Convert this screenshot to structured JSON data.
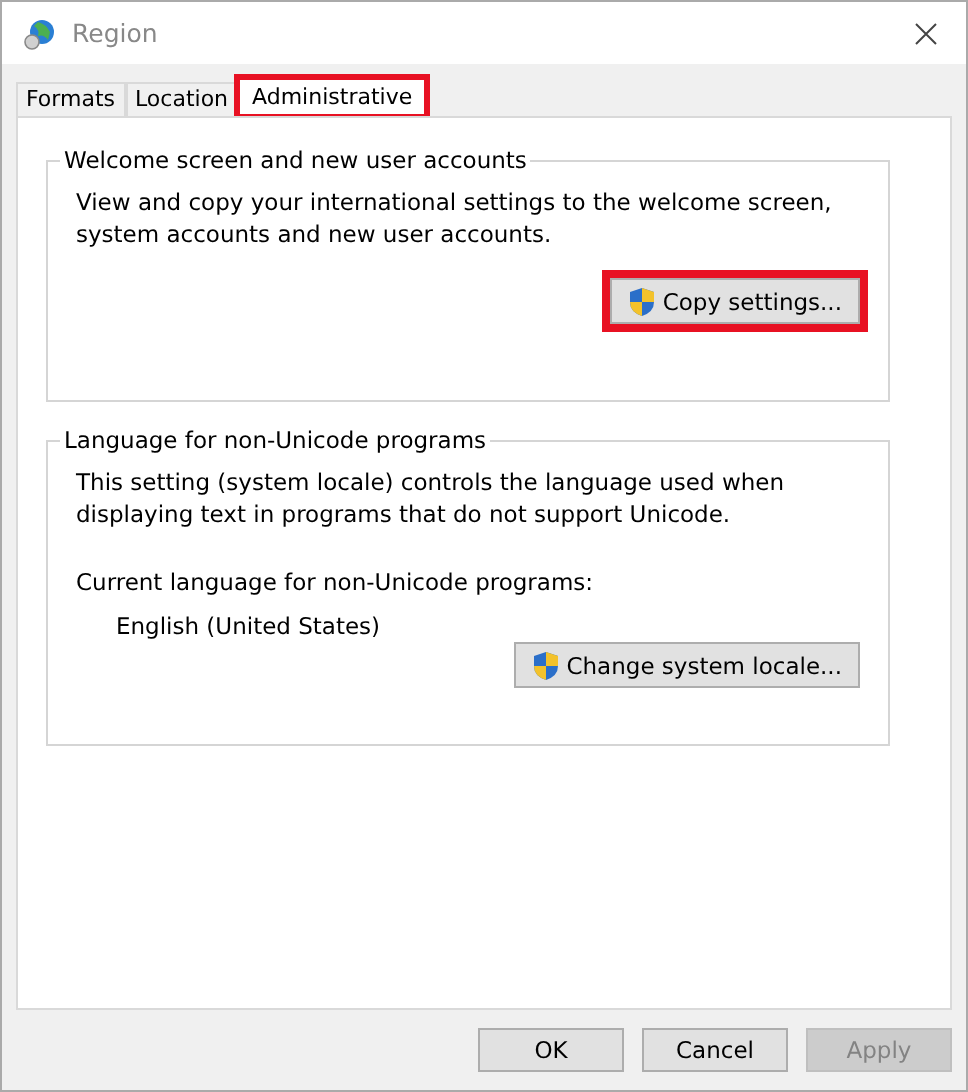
{
  "window": {
    "title": "Region"
  },
  "tabs": [
    {
      "label": "Formats",
      "selected": false,
      "highlighted": false
    },
    {
      "label": "Location",
      "selected": false,
      "highlighted": false
    },
    {
      "label": "Administrative",
      "selected": true,
      "highlighted": true
    }
  ],
  "groups": [
    {
      "title": "Welcome screen and new user accounts",
      "text": "View and copy your international settings to the welcome screen, system accounts and new user accounts.",
      "button": {
        "label": "Copy settings...",
        "highlighted": true
      }
    },
    {
      "title": "Language for non-Unicode programs",
      "text": "This setting (system locale) controls the language used when displaying text in programs that do not support Unicode.",
      "current_label": "Current language for non-Unicode programs:",
      "current_value": "English (United States)",
      "button": {
        "label": "Change system locale...",
        "highlighted": false
      }
    }
  ],
  "buttons": [
    {
      "label": "OK",
      "disabled": false
    },
    {
      "label": "Cancel",
      "disabled": false
    },
    {
      "label": "Apply",
      "disabled": true
    }
  ]
}
